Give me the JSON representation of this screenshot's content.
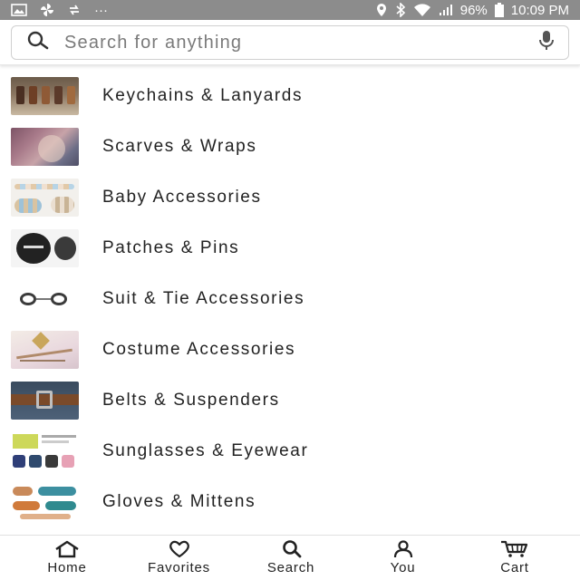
{
  "status_bar": {
    "battery": "96%",
    "time": "10:09 PM",
    "dots": "···"
  },
  "search": {
    "placeholder": "Search for anything"
  },
  "categories": [
    {
      "label": "Keychains & Lanyards"
    },
    {
      "label": "Scarves & Wraps"
    },
    {
      "label": "Baby Accessories"
    },
    {
      "label": "Patches & Pins"
    },
    {
      "label": "Suit & Tie Accessories"
    },
    {
      "label": "Costume Accessories"
    },
    {
      "label": "Belts & Suspenders"
    },
    {
      "label": "Sunglasses & Eyewear"
    },
    {
      "label": "Gloves & Mittens"
    }
  ],
  "bottom_nav": {
    "home": "Home",
    "favorites": "Favorites",
    "search": "Search",
    "you": "You",
    "cart": "Cart"
  },
  "colors": {
    "status_bar_bg": "#8c8c8c",
    "text": "#222222"
  }
}
